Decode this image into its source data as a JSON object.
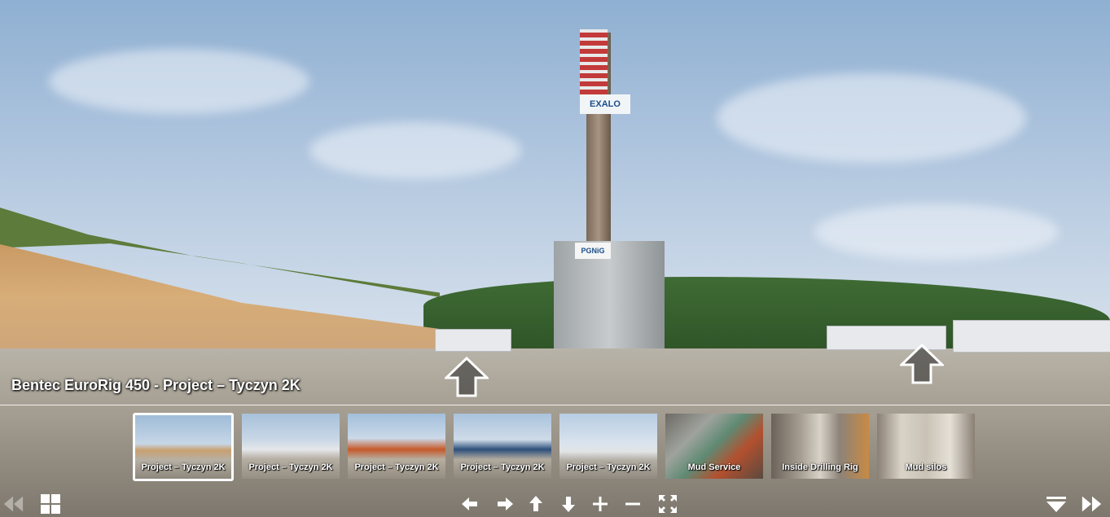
{
  "panorama": {
    "title": "Bentec EuroRig 450 - Project – Tyczyn 2K",
    "rig_sign": "EXALO",
    "base_sign": "PGNiG"
  },
  "thumbnails": [
    {
      "label": "Project – Tyczyn 2K",
      "active": true
    },
    {
      "label": "Project – Tyczyn 2K",
      "active": false
    },
    {
      "label": "Project – Tyczyn 2K",
      "active": false
    },
    {
      "label": "Project – Tyczyn 2K",
      "active": false
    },
    {
      "label": "Project – Tyczyn 2K",
      "active": false
    },
    {
      "label": "Mud Service",
      "active": false
    },
    {
      "label": "Inside Drilling Rig",
      "active": false
    },
    {
      "label": "Mud silos",
      "active": false
    }
  ],
  "toolbar": {
    "icons": [
      "previous-panorama-icon",
      "thumbnails-grid-icon",
      "pan-left-icon",
      "pan-right-icon",
      "pan-up-icon",
      "pan-down-icon",
      "zoom-in-icon",
      "zoom-out-icon",
      "fullscreen-icon",
      "hide-thumbnails-icon",
      "next-panorama-icon"
    ]
  }
}
